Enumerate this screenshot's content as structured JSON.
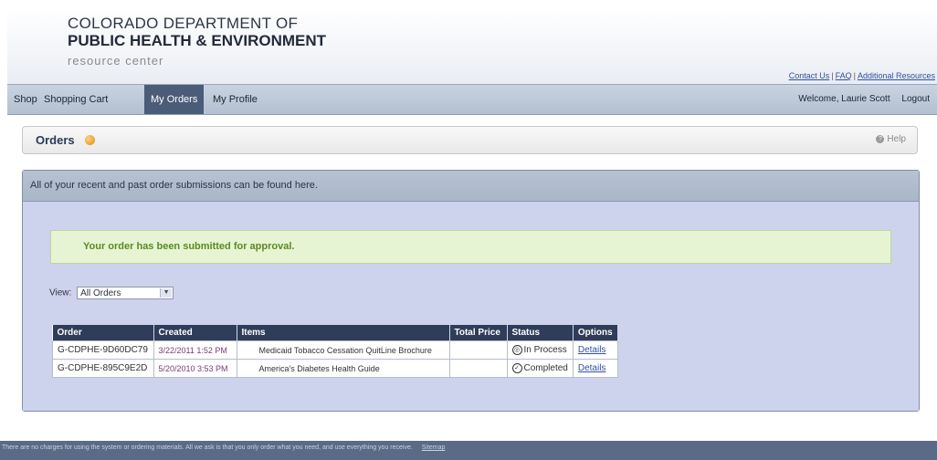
{
  "header": {
    "logo_line1": "COLORADO DEPARTMENT OF",
    "logo_line2": "PUBLIC HEALTH & ENVIRONMENT",
    "logo_line3": "resource center",
    "links": [
      "Contact Us",
      "FAQ",
      "Additional Resources"
    ],
    "link_separator": "|"
  },
  "nav": {
    "items": [
      "Shop",
      "Shopping Cart",
      "My Orders",
      "My Profile"
    ],
    "active": "My Orders",
    "welcome": "Welcome, Laurie Scott",
    "logout": "Logout"
  },
  "titlebar": {
    "title": "Orders",
    "help": "Help"
  },
  "panel": {
    "heading": "All of your recent and past order submissions can be found here.",
    "success_message": "Your order has been submitted for approval.",
    "view_label": "View:",
    "view_selected": "All Orders"
  },
  "table": {
    "headers": [
      "Order",
      "Created",
      "Items",
      "Total Price",
      "Status",
      "Options"
    ],
    "rows": [
      {
        "order": "G-CDPHE-9D60DC79",
        "created": "3/22/2011 1:52 PM",
        "items": "Medicaid Tobacco Cessation QuitLine Brochure",
        "total": "",
        "status": "In Process",
        "status_icon": "in-process-icon",
        "option": "Details"
      },
      {
        "order": "G-CDPHE-895C9E2D",
        "created": "5/20/2010 3:53 PM",
        "items": "America's Diabetes Health Guide",
        "total": "",
        "status": "Completed",
        "status_icon": "completed-check-icon",
        "option": "Details"
      }
    ]
  },
  "footer": {
    "text": "There are no charges for using the system or ordering materials. All we ask is that you only order what you need, and use everything you receive.",
    "sitemap": "Sitemap"
  },
  "colors": {
    "nav_active": "#4b5c78",
    "table_header": "#2f3c5a",
    "success_text": "#5b8a22",
    "footer": "#5b6a86",
    "panel_body": "#cdd3ec"
  }
}
